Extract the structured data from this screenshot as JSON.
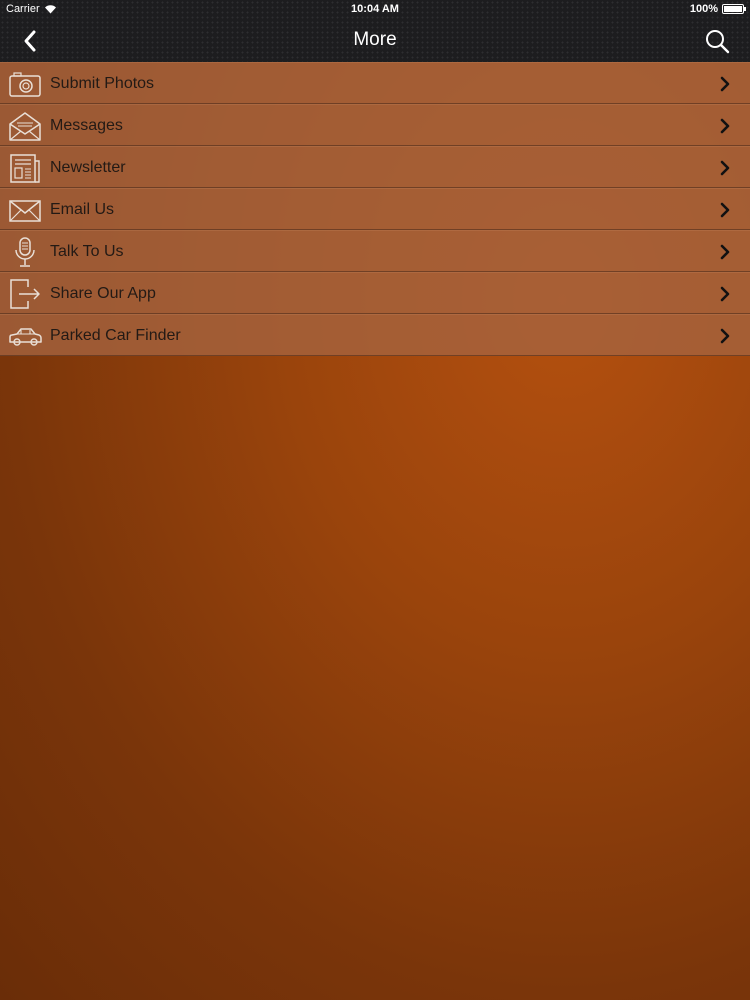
{
  "status_bar": {
    "carrier": "Carrier",
    "time": "10:04 AM",
    "battery": "100%"
  },
  "nav": {
    "title": "More",
    "back_icon": "chevron-left-icon",
    "search_icon": "search-icon"
  },
  "menu": {
    "items": [
      {
        "label": "Submit Photos",
        "icon": "camera-icon"
      },
      {
        "label": "Messages",
        "icon": "envelope-open-icon"
      },
      {
        "label": "Newsletter",
        "icon": "newspaper-icon"
      },
      {
        "label": "Email Us",
        "icon": "mail-icon"
      },
      {
        "label": "Talk To Us",
        "icon": "microphone-icon"
      },
      {
        "label": "Share Our App",
        "icon": "share-icon"
      },
      {
        "label": "Parked Car Finder",
        "icon": "car-icon"
      }
    ]
  },
  "colors": {
    "accent": "#b4500f",
    "row": "#a56440",
    "bar": "#1d1d1f"
  }
}
